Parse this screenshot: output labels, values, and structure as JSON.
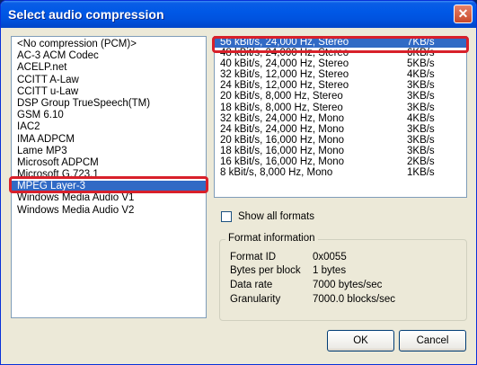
{
  "window": {
    "title": "Select audio compression",
    "close_label": "✕"
  },
  "codecs": [
    "<No compression (PCM)>",
    "AC-3 ACM Codec",
    "ACELP.net",
    "CCITT A-Law",
    "CCITT u-Law",
    "DSP Group TrueSpeech(TM)",
    "GSM 6.10",
    "IAC2",
    "IMA ADPCM",
    "Lame MP3",
    "Microsoft ADPCM",
    "Microsoft G.723.1",
    "MPEG Layer-3",
    "Windows Media Audio V1",
    "Windows Media Audio V2"
  ],
  "selected_codec": "MPEG Layer-3",
  "formats": [
    {
      "format": "56 kBit/s, 24,000 Hz, Stereo",
      "rate": "7KB/s",
      "selected": true
    },
    {
      "format": "48 kBit/s, 24,000 Hz, Stereo",
      "rate": "6KB/s"
    },
    {
      "format": "40 kBit/s, 24,000 Hz, Stereo",
      "rate": "5KB/s"
    },
    {
      "format": "32 kBit/s, 12,000 Hz, Stereo",
      "rate": "4KB/s"
    },
    {
      "format": "24 kBit/s, 12,000 Hz, Stereo",
      "rate": "3KB/s"
    },
    {
      "format": "20 kBit/s, 8,000 Hz, Stereo",
      "rate": "3KB/s"
    },
    {
      "format": "18 kBit/s, 8,000 Hz, Stereo",
      "rate": "3KB/s"
    },
    {
      "format": "32 kBit/s, 24,000 Hz, Mono",
      "rate": "4KB/s"
    },
    {
      "format": "24 kBit/s, 24,000 Hz, Mono",
      "rate": "3KB/s"
    },
    {
      "format": "20 kBit/s, 16,000 Hz, Mono",
      "rate": "3KB/s"
    },
    {
      "format": "18 kBit/s, 16,000 Hz, Mono",
      "rate": "3KB/s"
    },
    {
      "format": "16 kBit/s, 16,000 Hz, Mono",
      "rate": "2KB/s"
    },
    {
      "format": "8 kBit/s, 8,000 Hz, Mono",
      "rate": "1KB/s"
    }
  ],
  "show_all_formats": {
    "label": "Show all formats",
    "checked": false
  },
  "format_info": {
    "title": "Format information",
    "rows": [
      {
        "key": "Format ID",
        "value": "0x0055"
      },
      {
        "key": "Bytes per block",
        "value": "1 bytes"
      },
      {
        "key": "Data rate",
        "value": "7000 bytes/sec"
      },
      {
        "key": "Granularity",
        "value": "7000.0 blocks/sec"
      }
    ]
  },
  "buttons": {
    "ok": "OK",
    "cancel": "Cancel"
  },
  "highlight_color": "#d8202a",
  "selection_color": "#316ac5"
}
